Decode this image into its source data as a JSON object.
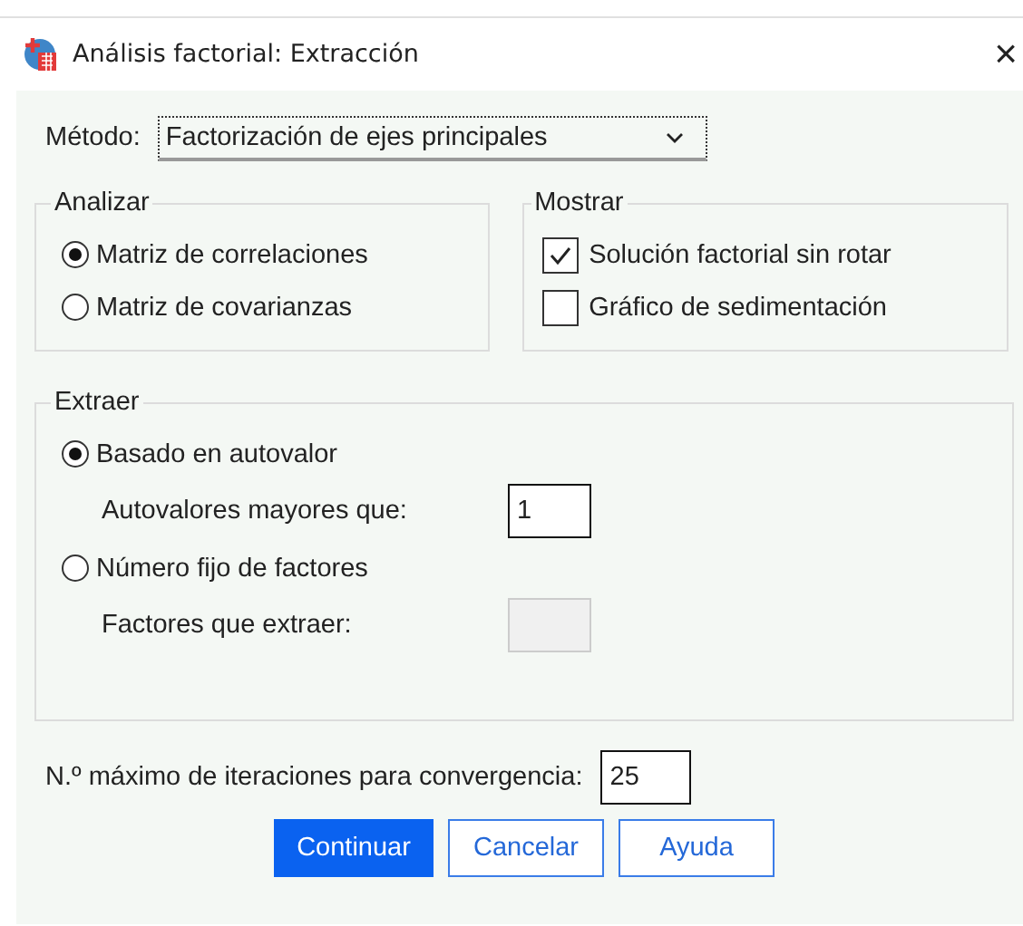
{
  "window": {
    "title": "Análisis factorial: Extracción",
    "close": "×"
  },
  "method": {
    "label": "Método:",
    "value": "Factorización de ejes principales"
  },
  "analizar": {
    "title": "Analizar",
    "options": [
      {
        "label": "Matriz de correlaciones",
        "selected": true
      },
      {
        "label": "Matriz de covarianzas",
        "selected": false
      }
    ]
  },
  "mostrar": {
    "title": "Mostrar",
    "options": [
      {
        "label": "Solución factorial sin rotar",
        "checked": true
      },
      {
        "label": "Gráfico de sedimentación",
        "checked": false
      }
    ]
  },
  "extraer": {
    "title": "Extraer",
    "options": [
      {
        "label": "Basado en autovalor",
        "selected": true,
        "field": {
          "label": "Autovalores mayores que:",
          "value": "1",
          "disabled": false
        }
      },
      {
        "label": "Número fijo de factores",
        "selected": false,
        "field": {
          "label": "Factores que extraer:",
          "disabled": true
        }
      }
    ]
  },
  "iterations": {
    "label": "N.º máximo de iteraciones para convergencia:",
    "value": "25"
  },
  "buttons": [
    {
      "label": "Continuar",
      "kind": "primary"
    },
    {
      "label": "Cancelar",
      "kind": "normal"
    },
    {
      "label": "Ayuda",
      "kind": "normal"
    }
  ]
}
